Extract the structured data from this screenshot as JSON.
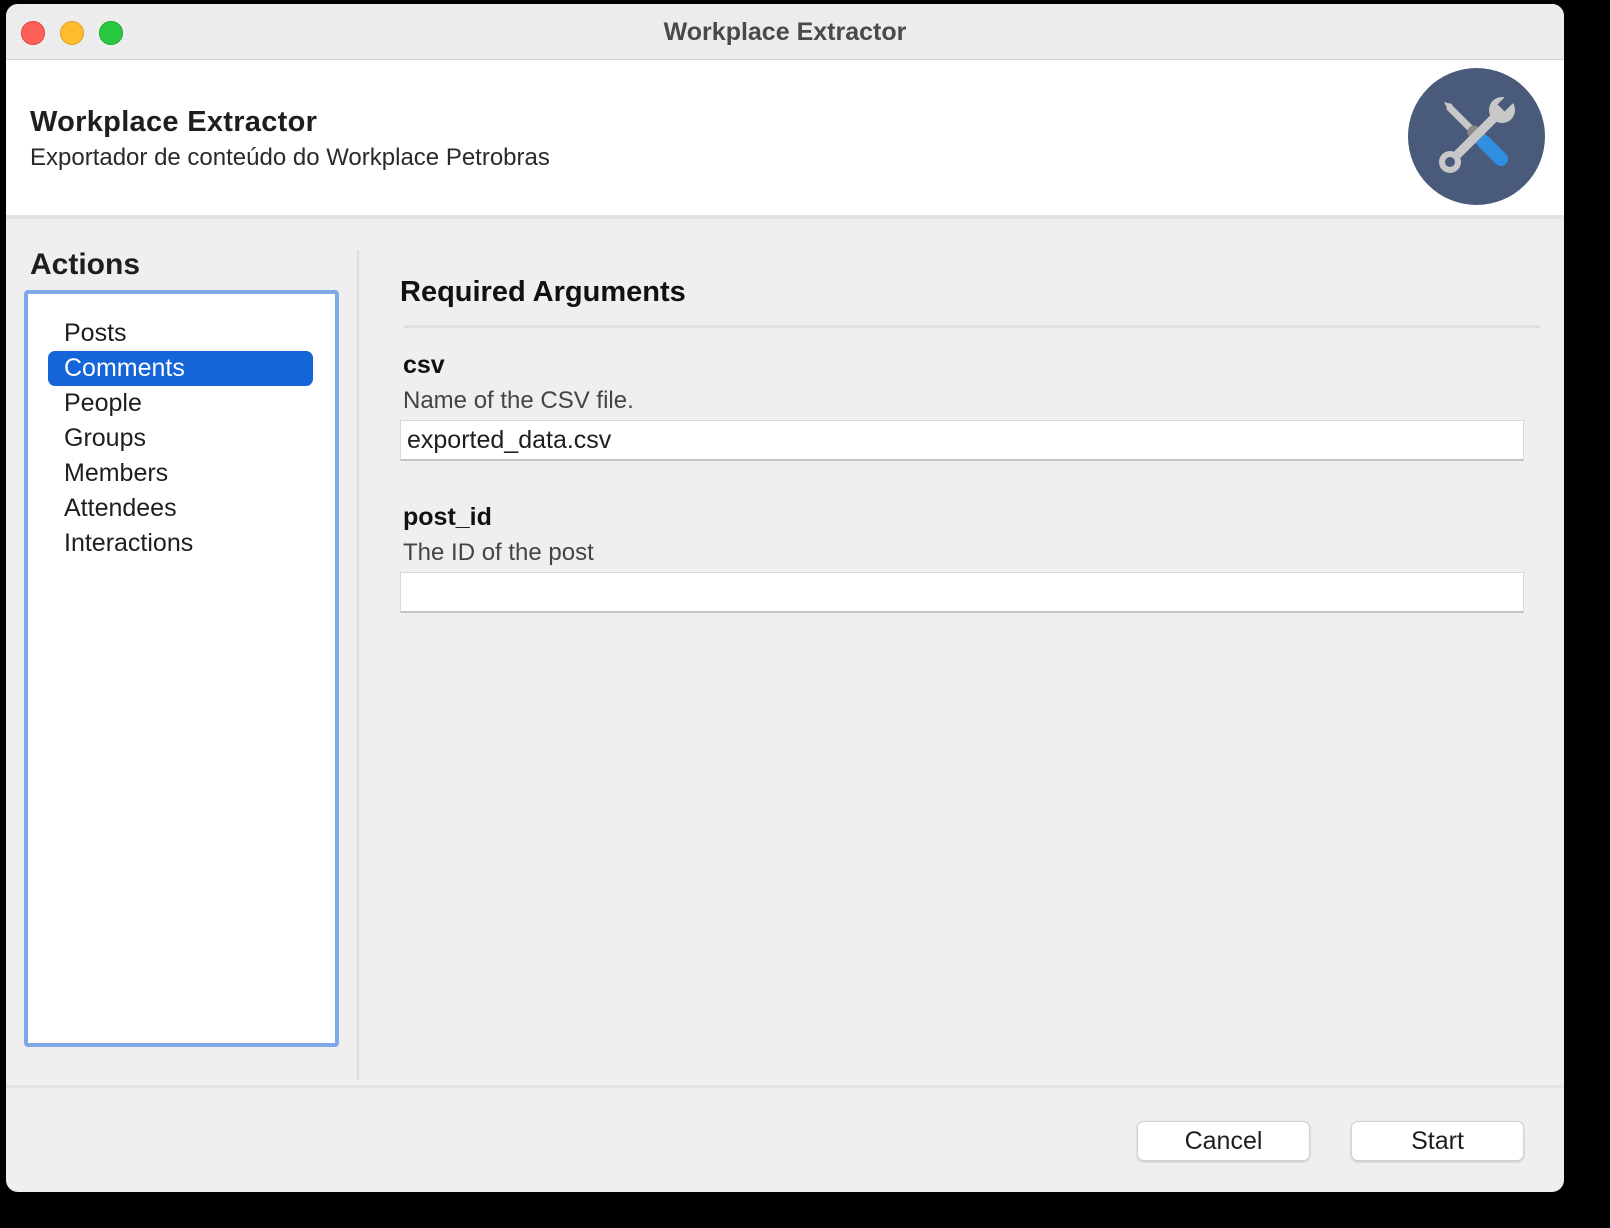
{
  "window": {
    "title": "Workplace Extractor"
  },
  "header": {
    "title": "Workplace Extractor",
    "subtitle": "Exportador de conteúdo do Workplace Petrobras",
    "logo_icon": "tools-icon"
  },
  "sidebar": {
    "heading": "Actions",
    "selected": "Comments",
    "items": [
      {
        "label": "Posts"
      },
      {
        "label": "Comments"
      },
      {
        "label": "People"
      },
      {
        "label": "Groups"
      },
      {
        "label": "Members"
      },
      {
        "label": "Attendees"
      },
      {
        "label": "Interactions"
      }
    ]
  },
  "main": {
    "section_title": "Required Arguments",
    "arguments": [
      {
        "name": "csv",
        "description": "Name of the CSV file.",
        "value": "exported_data.csv"
      },
      {
        "name": "post_id",
        "description": "The ID of the post",
        "value": ""
      }
    ]
  },
  "footer": {
    "cancel_label": "Cancel",
    "start_label": "Start"
  },
  "colors": {
    "selection": "#1565d8",
    "list_focus_border": "#7fa8e9",
    "logo_background": "#4a5a7a",
    "close": "#fe5f57",
    "minimize": "#febc2e",
    "maximize": "#28c840"
  }
}
